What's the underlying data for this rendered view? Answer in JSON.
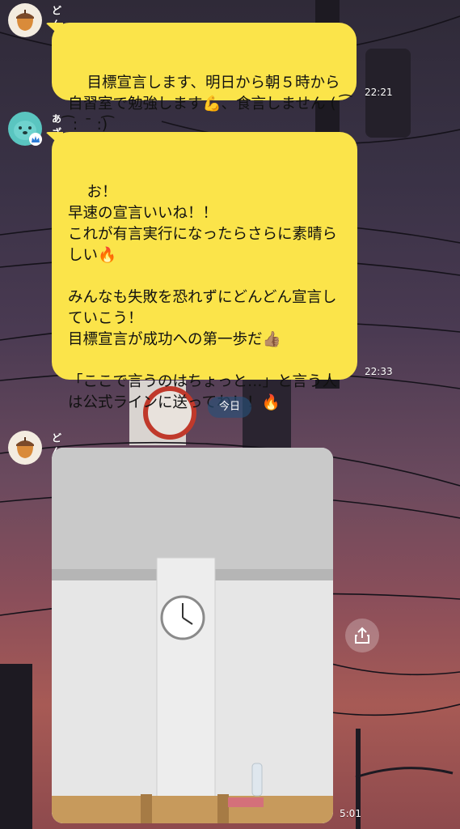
{
  "messages": [
    {
      "sender": "どんぐり",
      "avatar": "acorn-icon",
      "text": "目標宣言します、明日から朝５時から自習室で勉強します💪、食言しません (  ͡ : ︎  ̄ :)͡",
      "time": "22:21"
    },
    {
      "sender": "あざらし",
      "avatar": "seal-icon",
      "text": "お！\n早速の宣言いいね！！\nこれが有言実行になったらさらに素晴らしい🔥\n\nみんなも失敗を恐れずにどんどん宣言していこう！\n目標宣言が成功への第一歩だ👍🏽\n\n「ここで言うのはちょっと…」と言う人は公式ラインに送ってね！！🔥",
      "time": "22:33"
    }
  ],
  "date_separator": "今日",
  "photo_message": {
    "sender": "どんぐり",
    "avatar": "acorn-icon",
    "time": "5:01",
    "image": "study-room-clock-photo"
  },
  "share_icon": "share-icon",
  "colors": {
    "bubble": "#fbe44a",
    "date_badge": "#285078"
  }
}
